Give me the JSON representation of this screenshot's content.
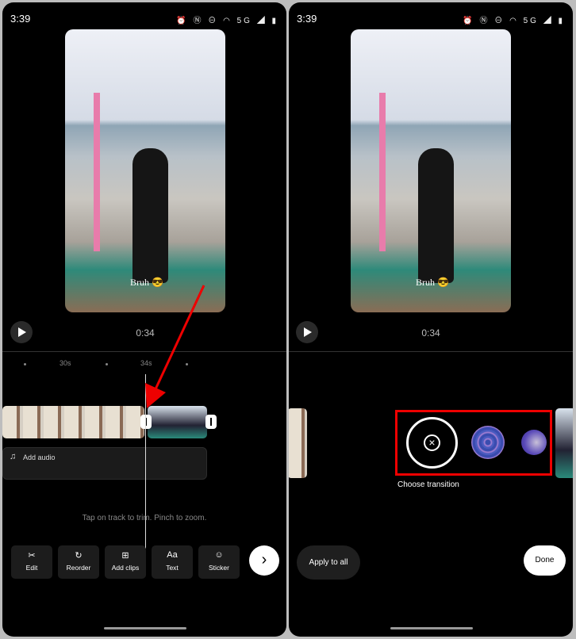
{
  "status_bar": {
    "time": "3:39",
    "icons": [
      "alarm-icon",
      "nfc-icon",
      "dnd-icon",
      "volte-icon",
      "hotspot-icon",
      "5g-icon",
      "signal-icon",
      "battery-icon"
    ]
  },
  "left": {
    "video_caption": "Bruh 😎",
    "duration": "0:34",
    "ruler": [
      "30s",
      "34s"
    ],
    "add_audio": "Add audio",
    "hint": "Tap on track to trim. Pinch to zoom.",
    "tools": [
      {
        "label": "Edit",
        "icon": "scissors-icon",
        "glyph": "✂"
      },
      {
        "label": "Reorder",
        "icon": "reorder-icon",
        "glyph": "↻"
      },
      {
        "label": "Add clips",
        "icon": "add-clips-icon",
        "glyph": "⊞"
      },
      {
        "label": "Text",
        "icon": "text-icon",
        "glyph": "Aa"
      },
      {
        "label": "Sticker",
        "icon": "sticker-icon",
        "glyph": "☺"
      }
    ],
    "next_glyph": "›"
  },
  "right": {
    "video_caption": "Bruh 😎",
    "duration": "0:34",
    "choose_transition": "Choose transition",
    "none_glyph": "×",
    "apply_all": "Apply to all",
    "done": "Done"
  },
  "colors": {
    "annotation": "#e00000"
  }
}
